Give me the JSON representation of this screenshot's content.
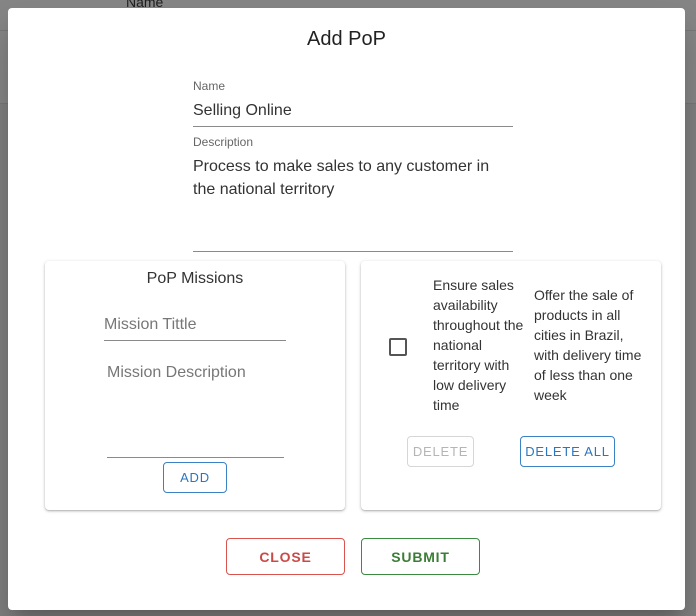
{
  "backdrop": {
    "column_label": "Name"
  },
  "dialog": {
    "title": "Add PoP",
    "name_label": "Name",
    "name_value": "Selling Online",
    "description_label": "Description",
    "description_value": "Process to make sales to any customer in the national territory"
  },
  "missions_card": {
    "title": "PoP Missions",
    "mission_title_placeholder": "Mission Tittle",
    "mission_description_placeholder": "Mission Description",
    "add_label": "ADD"
  },
  "missions_list": {
    "row": {
      "checked": false,
      "title": "Ensure sales availability throughout the national territory with low delivery time",
      "description": "Offer the sale of products in all cities in Brazil, with delivery time of less than one week"
    },
    "delete_label": "DELETE",
    "delete_all_label": "DELETE ALL"
  },
  "actions": {
    "close_label": "CLOSE",
    "submit_label": "SUBMIT"
  }
}
